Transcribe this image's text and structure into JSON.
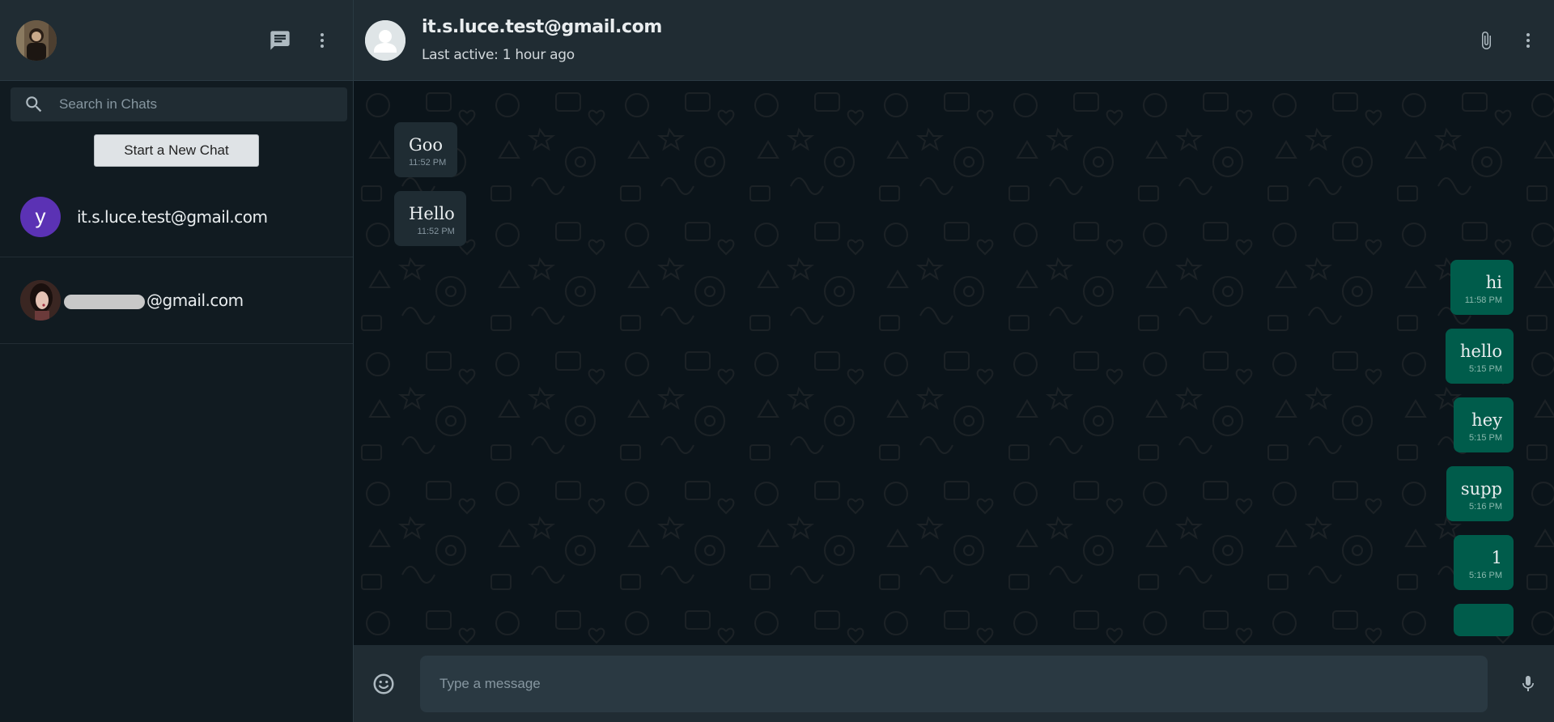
{
  "sidebar": {
    "search_placeholder": "Search in Chats",
    "new_chat_label": "Start a New Chat",
    "chats": [
      {
        "avatar_letter": "y",
        "name": "it.s.luce.test@gmail.com"
      },
      {
        "name_suffix": "@gmail.com"
      }
    ]
  },
  "conversation": {
    "contact_name": "it.s.luce.test@gmail.com",
    "last_active": "Last active: 1 hour ago",
    "messages": [
      {
        "text": "Goo",
        "time": "11:52 PM",
        "direction": "in"
      },
      {
        "text": "Hello",
        "time": "11:52 PM",
        "direction": "in"
      },
      {
        "text": "hi",
        "time": "11:58 PM",
        "direction": "out"
      },
      {
        "text": "hello",
        "time": "5:15 PM",
        "direction": "out"
      },
      {
        "text": "hey",
        "time": "5:15 PM",
        "direction": "out"
      },
      {
        "text": "supp",
        "time": "5:16 PM",
        "direction": "out"
      },
      {
        "text": "1",
        "time": "5:16 PM",
        "direction": "out"
      }
    ]
  },
  "composer": {
    "placeholder": "Type a message"
  },
  "icons": {
    "new_chat": "chat-icon",
    "menu": "more-vert-icon",
    "search": "search-icon",
    "attach": "paperclip-icon",
    "emoji": "emoji-icon",
    "mic": "mic-icon"
  },
  "colors": {
    "incoming_bubble": "#1f2c33",
    "outgoing_bubble": "#005c4b",
    "header_bg": "#202c33",
    "chat_bg": "#0b141a",
    "letter_avatar": "#5b32b4"
  }
}
